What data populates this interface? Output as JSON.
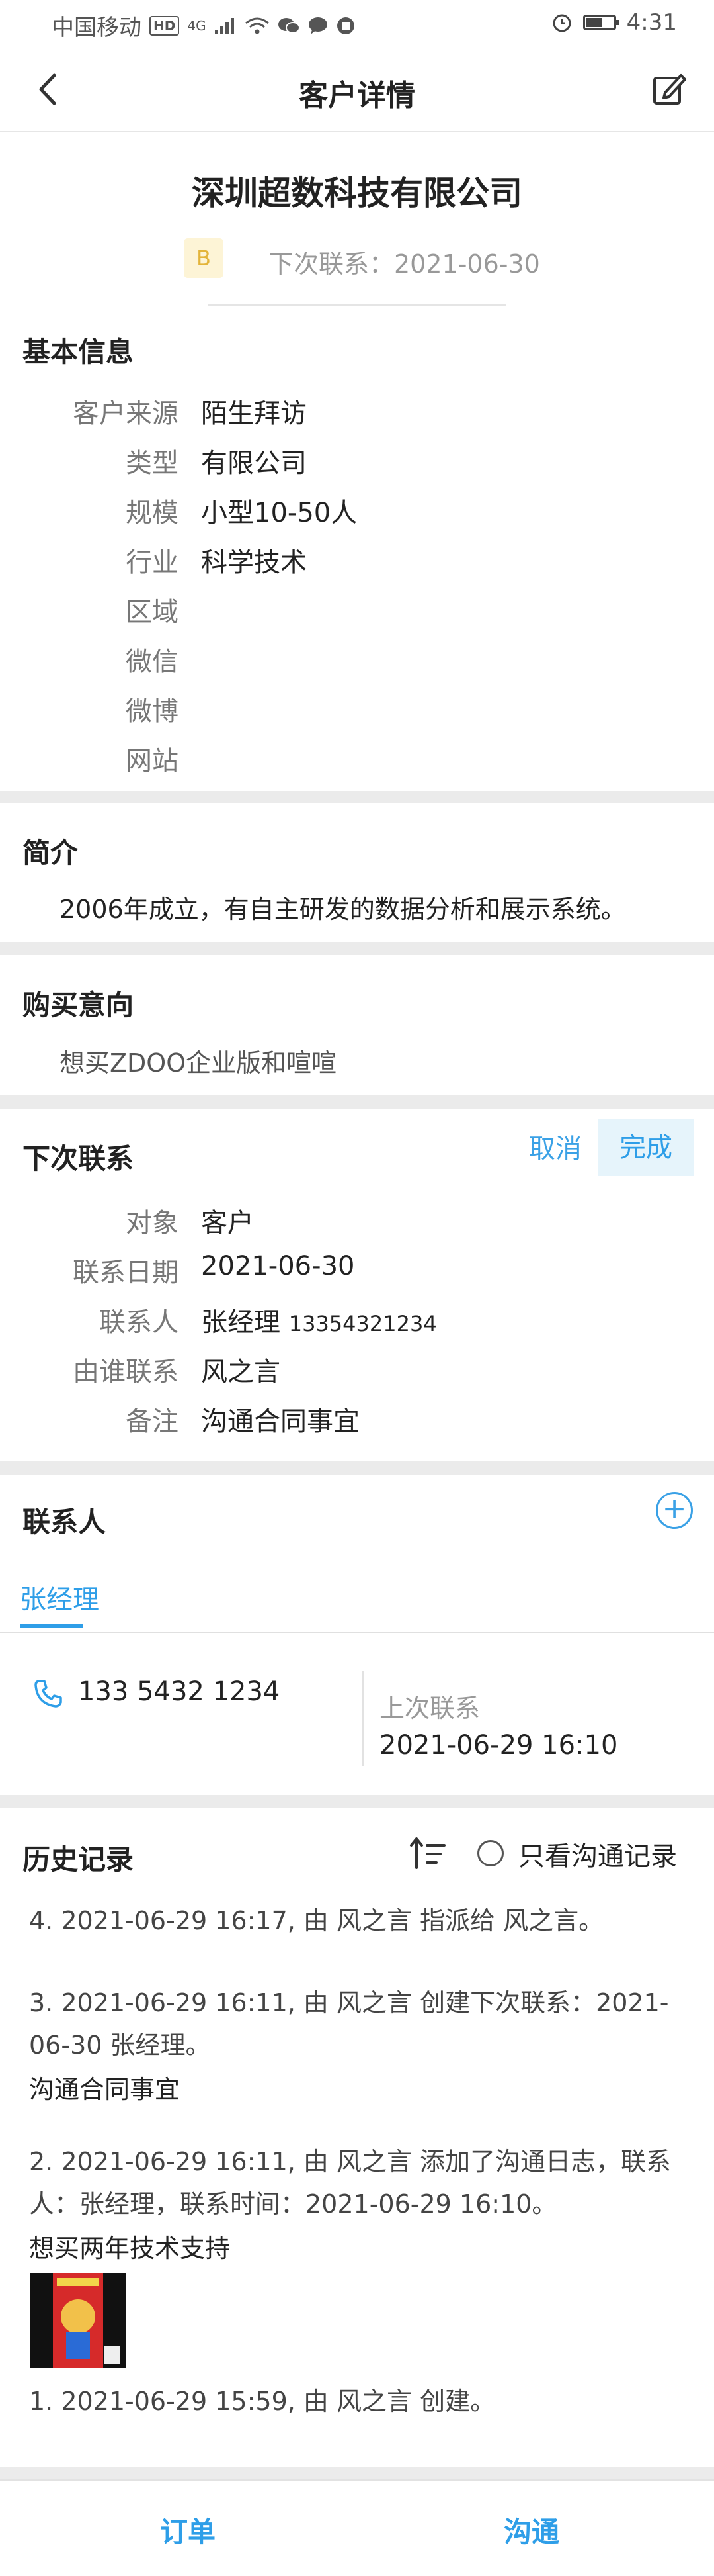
{
  "status_bar": {
    "carrier": "中国移动",
    "network_badge": "HD",
    "signal_label": "4G",
    "time": "4:31",
    "icons": [
      "signal-icon",
      "wifi-icon",
      "wechat-icon",
      "message-icon",
      "app-icon",
      "alarm-icon",
      "battery-icon"
    ]
  },
  "header": {
    "title": "客户详情",
    "back_icon": "chevron-left-icon",
    "edit_icon": "edit-icon"
  },
  "company": {
    "name": "深圳超数科技有限公司",
    "grade": "B",
    "next_contact": "下次联系：2021-06-30"
  },
  "basic_info": {
    "title": "基本信息",
    "rows": [
      {
        "label": "客户来源",
        "value": "陌生拜访"
      },
      {
        "label": "类型",
        "value": "有限公司"
      },
      {
        "label": "规模",
        "value": "小型10-50人"
      },
      {
        "label": "行业",
        "value": "科学技术"
      },
      {
        "label": "区域",
        "value": ""
      },
      {
        "label": "微信",
        "value": ""
      },
      {
        "label": "微博",
        "value": ""
      },
      {
        "label": "网站",
        "value": ""
      }
    ]
  },
  "intro": {
    "title": "简介",
    "text": "2006年成立，有自主研发的数据分析和展示系统。"
  },
  "intent": {
    "title": "购买意向",
    "text": "想买ZDOO企业版和喧喧"
  },
  "next_contact": {
    "title": "下次联系",
    "cancel_label": "取消",
    "done_label": "完成",
    "rows": [
      {
        "label": "对象",
        "value": "客户"
      },
      {
        "label": "联系日期",
        "value": "2021-06-30"
      },
      {
        "label": "联系人",
        "value": "张经理",
        "extra": "13354321234"
      },
      {
        "label": "由谁联系",
        "value": "风之言"
      },
      {
        "label": "备注",
        "value": "沟通合同事宜"
      }
    ]
  },
  "contacts": {
    "title": "联系人",
    "tab_name": "张经理",
    "phone": "133 5432 1234",
    "last_contact_label": "上次联系",
    "last_contact_value": "2021-06-29 16:10"
  },
  "history": {
    "title": "历史记录",
    "filter_label": "只看沟通记录",
    "entries": [
      {
        "text": "4. 2021-06-29 16:17, 由 风之言 指派给 风之言。",
        "note": ""
      },
      {
        "text": "3. 2021-06-29 16:11, 由 风之言 创建下次联系：2021-06-30 张经理。",
        "note": "沟通合同事宜"
      },
      {
        "text": "2. 2021-06-29 16:11, 由 风之言 添加了沟通日志，联系人：张经理，联系时间：2021-06-29 16:10。",
        "note": "想买两年技术支持"
      },
      {
        "text": "1. 2021-06-29 15:59, 由 风之言 创建。",
        "note": ""
      }
    ]
  },
  "bottom_tabs": {
    "orders": "订单",
    "communicate": "沟通"
  },
  "colors": {
    "accent": "#2e9ee8",
    "badge_bg": "#fdf4d6",
    "badge_text": "#e3b43a",
    "separator": "#ebebeb"
  }
}
